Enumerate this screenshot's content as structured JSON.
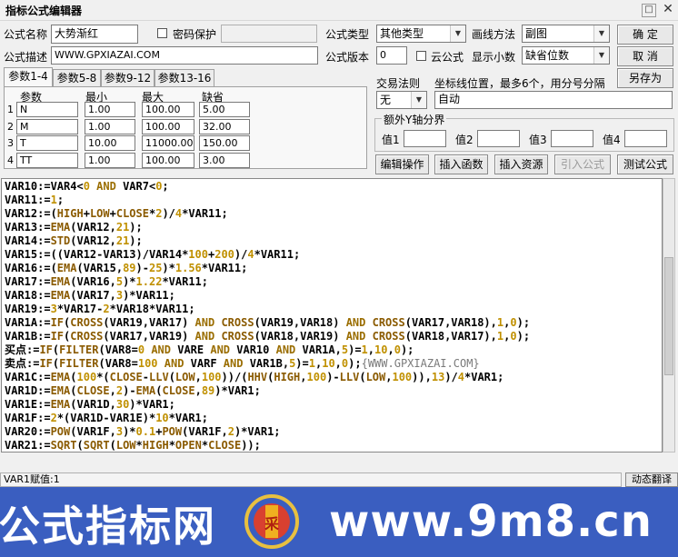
{
  "window": {
    "title": "指标公式编辑器"
  },
  "form": {
    "name_label": "公式名称",
    "name_value": "大势渐红",
    "password_label": "密码保护",
    "desc_label": "公式描述",
    "desc_value": "WWW.GPXIAZAI.COM",
    "type_label": "公式类型",
    "type_value": "其他类型",
    "draw_label": "画线方法",
    "draw_value": "副图",
    "version_label": "公式版本",
    "version_value": "0",
    "cloud_label": "云公式",
    "decimal_label": "显示小数",
    "decimal_value": "缺省位数"
  },
  "buttons": {
    "ok": "确  定",
    "cancel": "取  消",
    "save_as": "另存为",
    "edit_op": "编辑操作",
    "insert_func": "插入函数",
    "insert_res": "插入资源",
    "import": "引入公式",
    "test": "测试公式"
  },
  "tabs": [
    "参数1-4",
    "参数5-8",
    "参数9-12",
    "参数13-16"
  ],
  "params": {
    "headers": [
      "参数",
      "最小",
      "最大",
      "缺省"
    ],
    "rows": [
      {
        "n": "1",
        "name": "N",
        "min": "1.00",
        "max": "100.00",
        "def": "5.00"
      },
      {
        "n": "2",
        "name": "M",
        "min": "1.00",
        "max": "100.00",
        "def": "32.00"
      },
      {
        "n": "3",
        "name": "T",
        "min": "10.00",
        "max": "11000.00",
        "def": "150.00"
      },
      {
        "n": "4",
        "name": "TT",
        "min": "1.00",
        "max": "100.00",
        "def": "3.00"
      }
    ]
  },
  "trade": {
    "rule_label": "交易法则",
    "rule_value": "无",
    "coord_label": "坐标线位置，最多6个，用分号分隔",
    "coord_value": "自动"
  },
  "yaxis": {
    "title": "额外Y轴分界",
    "labels": [
      "值1",
      "值2",
      "值3",
      "值4"
    ]
  },
  "code_lines": [
    [
      [
        "v",
        "VAR10:=VAR4<"
      ],
      [
        "n",
        "0"
      ],
      [
        "o",
        " AND "
      ],
      [
        "v",
        "VAR7<"
      ],
      [
        "n",
        "0"
      ],
      [
        "v",
        ";"
      ]
    ],
    [
      [
        "v",
        "VAR11:="
      ],
      [
        "n",
        "1"
      ],
      [
        "v",
        ";"
      ]
    ],
    [
      [
        "v",
        "VAR12:=("
      ],
      [
        "f",
        "HIGH"
      ],
      [
        "v",
        "+"
      ],
      [
        "f",
        "LOW"
      ],
      [
        "v",
        "+"
      ],
      [
        "f",
        "CLOSE"
      ],
      [
        "v",
        "*"
      ],
      [
        "n",
        "2"
      ],
      [
        "v",
        ")/"
      ],
      [
        "n",
        "4"
      ],
      [
        "v",
        "*VAR11;"
      ]
    ],
    [
      [
        "v",
        "VAR13:="
      ],
      [
        "f",
        "EMA"
      ],
      [
        "v",
        "(VAR12,"
      ],
      [
        "n",
        "21"
      ],
      [
        "v",
        ");"
      ]
    ],
    [
      [
        "v",
        "VAR14:="
      ],
      [
        "f",
        "STD"
      ],
      [
        "v",
        "(VAR12,"
      ],
      [
        "n",
        "21"
      ],
      [
        "v",
        ");"
      ]
    ],
    [
      [
        "v",
        "VAR15:=((VAR12-VAR13)/VAR14*"
      ],
      [
        "n",
        "100"
      ],
      [
        "v",
        "+"
      ],
      [
        "n",
        "200"
      ],
      [
        "v",
        ")/"
      ],
      [
        "n",
        "4"
      ],
      [
        "v",
        "*VAR11;"
      ]
    ],
    [
      [
        "v",
        "VAR16:=("
      ],
      [
        "f",
        "EMA"
      ],
      [
        "v",
        "(VAR15,"
      ],
      [
        "n",
        "89"
      ],
      [
        "v",
        ")-"
      ],
      [
        "n",
        "25"
      ],
      [
        "v",
        ")*"
      ],
      [
        "n",
        "1.56"
      ],
      [
        "v",
        "*VAR11;"
      ]
    ],
    [
      [
        "v",
        "VAR17:="
      ],
      [
        "f",
        "EMA"
      ],
      [
        "v",
        "(VAR16,"
      ],
      [
        "n",
        "5"
      ],
      [
        "v",
        ")*"
      ],
      [
        "n",
        "1.22"
      ],
      [
        "v",
        "*VAR11;"
      ]
    ],
    [
      [
        "v",
        "VAR18:="
      ],
      [
        "f",
        "EMA"
      ],
      [
        "v",
        "(VAR17,"
      ],
      [
        "n",
        "3"
      ],
      [
        "v",
        ")*VAR11;"
      ]
    ],
    [
      [
        "v",
        "VAR19:="
      ],
      [
        "n",
        "3"
      ],
      [
        "v",
        "*VAR17-"
      ],
      [
        "n",
        "2"
      ],
      [
        "v",
        "*VAR18*VAR11;"
      ]
    ],
    [
      [
        "v",
        "VAR1A:="
      ],
      [
        "f",
        "IF"
      ],
      [
        "v",
        "("
      ],
      [
        "f",
        "CROSS"
      ],
      [
        "v",
        "(VAR19,VAR17)"
      ],
      [
        "o",
        " AND "
      ],
      [
        "f",
        "CROSS"
      ],
      [
        "v",
        "(VAR19,VAR18)"
      ],
      [
        "o",
        " AND "
      ],
      [
        "f",
        "CROSS"
      ],
      [
        "v",
        "(VAR17,VAR18),"
      ],
      [
        "n",
        "1"
      ],
      [
        "v",
        ","
      ],
      [
        "n",
        "0"
      ],
      [
        "v",
        ");"
      ]
    ],
    [
      [
        "v",
        "VAR1B:="
      ],
      [
        "f",
        "IF"
      ],
      [
        "v",
        "("
      ],
      [
        "f",
        "CROSS"
      ],
      [
        "v",
        "(VAR17,VAR19)"
      ],
      [
        "o",
        " AND "
      ],
      [
        "f",
        "CROSS"
      ],
      [
        "v",
        "(VAR18,VAR19)"
      ],
      [
        "o",
        " AND "
      ],
      [
        "f",
        "CROSS"
      ],
      [
        "v",
        "(VAR18,VAR17),"
      ],
      [
        "n",
        "1"
      ],
      [
        "v",
        ","
      ],
      [
        "n",
        "0"
      ],
      [
        "v",
        ");"
      ]
    ],
    [
      [
        "v",
        "买点:="
      ],
      [
        "f",
        "IF"
      ],
      [
        "v",
        "("
      ],
      [
        "f",
        "FILTER"
      ],
      [
        "v",
        "(VAR8="
      ],
      [
        "n",
        "0"
      ],
      [
        "o",
        " AND "
      ],
      [
        "v",
        "VARE"
      ],
      [
        "o",
        " AND "
      ],
      [
        "v",
        "VAR10"
      ],
      [
        "o",
        " AND "
      ],
      [
        "v",
        "VAR1A,"
      ],
      [
        "n",
        "5"
      ],
      [
        "v",
        ")="
      ],
      [
        "n",
        "1"
      ],
      [
        "v",
        ","
      ],
      [
        "n",
        "10"
      ],
      [
        "v",
        ","
      ],
      [
        "n",
        "0"
      ],
      [
        "v",
        ");"
      ]
    ],
    [
      [
        "v",
        "卖点:="
      ],
      [
        "f",
        "IF"
      ],
      [
        "v",
        "("
      ],
      [
        "f",
        "FILTER"
      ],
      [
        "v",
        "(VAR8="
      ],
      [
        "n",
        "100"
      ],
      [
        "o",
        " AND "
      ],
      [
        "v",
        "VARF"
      ],
      [
        "o",
        " AND "
      ],
      [
        "v",
        "VAR1B,"
      ],
      [
        "n",
        "5"
      ],
      [
        "v",
        ")="
      ],
      [
        "n",
        "1"
      ],
      [
        "v",
        ","
      ],
      [
        "n",
        "10"
      ],
      [
        "v",
        ","
      ],
      [
        "n",
        "0"
      ],
      [
        "v",
        ");"
      ],
      [
        "c",
        "{WWW.GPXIAZAI.COM}"
      ]
    ],
    [
      [
        "v",
        "VAR1C:="
      ],
      [
        "f",
        "EMA"
      ],
      [
        "v",
        "("
      ],
      [
        "n",
        "100"
      ],
      [
        "v",
        "*("
      ],
      [
        "f",
        "CLOSE"
      ],
      [
        "v",
        "-"
      ],
      [
        "f",
        "LLV"
      ],
      [
        "v",
        "("
      ],
      [
        "f",
        "LOW"
      ],
      [
        "v",
        ","
      ],
      [
        "n",
        "100"
      ],
      [
        "v",
        "))/("
      ],
      [
        "f",
        "HHV"
      ],
      [
        "v",
        "("
      ],
      [
        "f",
        "HIGH"
      ],
      [
        "v",
        ","
      ],
      [
        "n",
        "100"
      ],
      [
        "v",
        ")-"
      ],
      [
        "f",
        "LLV"
      ],
      [
        "v",
        "("
      ],
      [
        "f",
        "LOW"
      ],
      [
        "v",
        ","
      ],
      [
        "n",
        "100"
      ],
      [
        "v",
        ")),"
      ],
      [
        "n",
        "13"
      ],
      [
        "v",
        ")/"
      ],
      [
        "n",
        "4"
      ],
      [
        "v",
        "*VAR1;"
      ]
    ],
    [
      [
        "v",
        "VAR1D:="
      ],
      [
        "f",
        "EMA"
      ],
      [
        "v",
        "("
      ],
      [
        "f",
        "CLOSE"
      ],
      [
        "v",
        ","
      ],
      [
        "n",
        "2"
      ],
      [
        "v",
        ")-"
      ],
      [
        "f",
        "EMA"
      ],
      [
        "v",
        "("
      ],
      [
        "f",
        "CLOSE"
      ],
      [
        "v",
        ","
      ],
      [
        "n",
        "89"
      ],
      [
        "v",
        ")*VAR1;"
      ]
    ],
    [
      [
        "v",
        "VAR1E:="
      ],
      [
        "f",
        "EMA"
      ],
      [
        "v",
        "(VAR1D,"
      ],
      [
        "n",
        "30"
      ],
      [
        "v",
        ")*VAR1;"
      ]
    ],
    [
      [
        "v",
        "VAR1F:="
      ],
      [
        "n",
        "2"
      ],
      [
        "v",
        "*(VAR1D-VAR1E)*"
      ],
      [
        "n",
        "10"
      ],
      [
        "v",
        "*VAR1;"
      ]
    ],
    [
      [
        "v",
        "VAR20:="
      ],
      [
        "f",
        "POW"
      ],
      [
        "v",
        "(VAR1F,"
      ],
      [
        "n",
        "3"
      ],
      [
        "v",
        ")*"
      ],
      [
        "n",
        "0.1"
      ],
      [
        "v",
        "+"
      ],
      [
        "f",
        "POW"
      ],
      [
        "v",
        "(VAR1F,"
      ],
      [
        "n",
        "2"
      ],
      [
        "v",
        ")*VAR1;"
      ]
    ],
    [
      [
        "v",
        "VAR21:="
      ],
      [
        "f",
        "SQRT"
      ],
      [
        "v",
        "("
      ],
      [
        "f",
        "SQRT"
      ],
      [
        "v",
        "("
      ],
      [
        "f",
        "LOW"
      ],
      [
        "v",
        "*"
      ],
      [
        "f",
        "HIGH"
      ],
      [
        "v",
        "*"
      ],
      [
        "f",
        "OPEN"
      ],
      [
        "v",
        "*"
      ],
      [
        "f",
        "CLOSE"
      ],
      [
        "v",
        "));"
      ]
    ]
  ],
  "status": {
    "text": "VAR1赋值:1",
    "right_button": "动态翻译"
  },
  "banner": {
    "left_text": "公式指标网",
    "right_text": "www.9m8.cn",
    "logo_char": "采"
  }
}
